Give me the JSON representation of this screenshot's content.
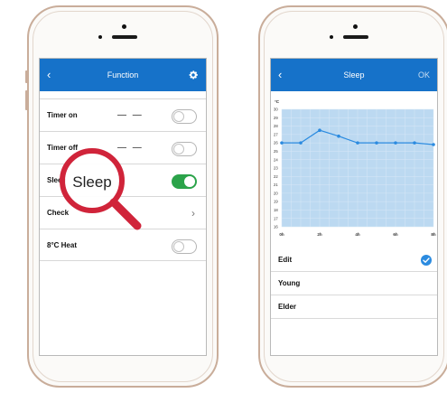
{
  "left_phone": {
    "nav": {
      "back_icon": "chevron-left-icon",
      "title": "Function",
      "settings_icon": "gear-icon"
    },
    "rows": [
      {
        "label": "Timer on",
        "value": "— —",
        "toggle": false
      },
      {
        "label": "Timer off",
        "value": "— —",
        "toggle": false
      },
      {
        "label": "Sleep",
        "toggle": true
      },
      {
        "label": "Check",
        "chevron": "›"
      },
      {
        "label": "8°C Heat",
        "toggle": false
      }
    ],
    "magnifier": {
      "label": "Sleep"
    }
  },
  "right_phone": {
    "nav": {
      "back_icon": "chevron-left-icon",
      "title": "Sleep",
      "action": "OK"
    },
    "options": [
      {
        "label": "Edit",
        "selected": true
      },
      {
        "label": "Young",
        "selected": false
      },
      {
        "label": "Elder",
        "selected": false
      }
    ]
  },
  "chart_data": {
    "type": "line",
    "y_unit": "°C",
    "x_ticks": [
      "0h",
      "2h",
      "4h",
      "6h",
      "8h"
    ],
    "y_ticks": [
      "30",
      "29",
      "28",
      "27",
      "26",
      "25",
      "24",
      "23",
      "22",
      "21",
      "20",
      "19",
      "18",
      "17",
      "16"
    ],
    "ylim": [
      16,
      30
    ],
    "x": [
      0,
      1,
      2,
      3,
      4,
      5,
      6,
      7,
      8
    ],
    "values": [
      26,
      26,
      27.5,
      26.8,
      26,
      26,
      26,
      26,
      25.8
    ],
    "area_color": "#bcd9f1",
    "line_color": "#2b8be0",
    "grid": true
  },
  "colors": {
    "nav_blue": "#1672c9",
    "toggle_green": "#2ba34a",
    "magnifier_red": "#d0243a"
  }
}
